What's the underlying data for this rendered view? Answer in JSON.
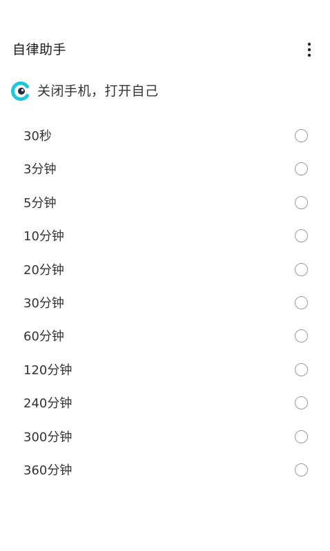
{
  "app_bar": {
    "title": "自律助手",
    "menu_icon": "more-vertical-icon"
  },
  "header": {
    "logo_icon": "app-logo-icon",
    "brand_color": "#1ec8d8",
    "tagline": "关闭手机，打开自己"
  },
  "options": [
    {
      "label": "30秒",
      "selected": false
    },
    {
      "label": "3分钟",
      "selected": false
    },
    {
      "label": "5分钟",
      "selected": false
    },
    {
      "label": "10分钟",
      "selected": false
    },
    {
      "label": "20分钟",
      "selected": false
    },
    {
      "label": "30分钟",
      "selected": false
    },
    {
      "label": "60分钟",
      "selected": false
    },
    {
      "label": "120分钟",
      "selected": false
    },
    {
      "label": "240分钟",
      "selected": false
    },
    {
      "label": "300分钟",
      "selected": false
    },
    {
      "label": "360分钟",
      "selected": false
    }
  ]
}
